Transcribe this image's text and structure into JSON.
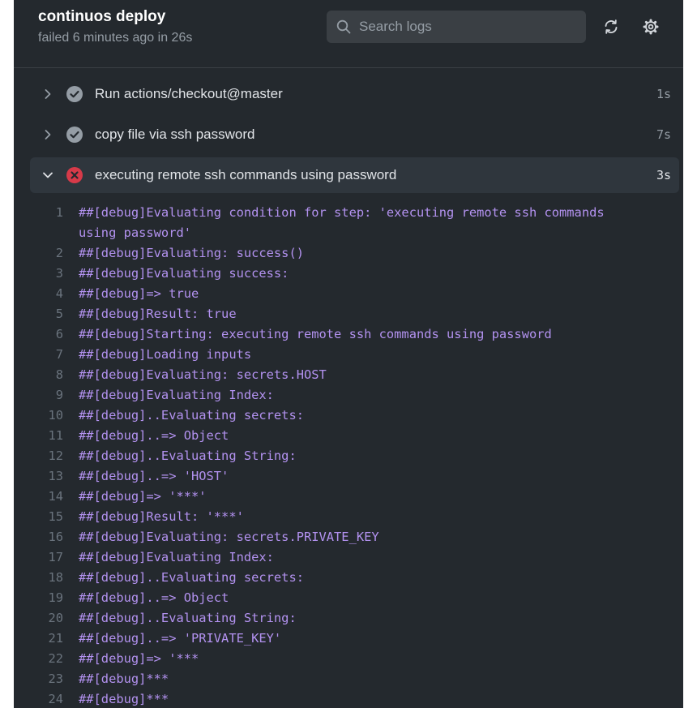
{
  "header": {
    "title": "continuos deploy",
    "subtitle": "failed 6 minutes ago in 26s",
    "search_placeholder": "Search logs"
  },
  "steps": [
    {
      "name": "Run actions/checkout@master",
      "time": "1s",
      "status": "success",
      "expanded": false
    },
    {
      "name": "copy file via ssh password",
      "time": "7s",
      "status": "success",
      "expanded": false
    },
    {
      "name": "executing remote ssh commands using password",
      "time": "3s",
      "status": "failure",
      "expanded": true
    }
  ],
  "colors": {
    "panel_bg": "#24292e",
    "log_text": "#b392f0",
    "failure": "#d73a49",
    "success": "#959da5"
  },
  "log_lines": [
    {
      "n": "1",
      "text": "##[debug]Evaluating condition for step: 'executing remote ssh commands using password'"
    },
    {
      "n": "2",
      "text": "##[debug]Evaluating: success()"
    },
    {
      "n": "3",
      "text": "##[debug]Evaluating success:"
    },
    {
      "n": "4",
      "text": "##[debug]=> true"
    },
    {
      "n": "5",
      "text": "##[debug]Result: true"
    },
    {
      "n": "6",
      "text": "##[debug]Starting: executing remote ssh commands using password"
    },
    {
      "n": "7",
      "text": "##[debug]Loading inputs"
    },
    {
      "n": "8",
      "text": "##[debug]Evaluating: secrets.HOST"
    },
    {
      "n": "9",
      "text": "##[debug]Evaluating Index:"
    },
    {
      "n": "10",
      "text": "##[debug]..Evaluating secrets:"
    },
    {
      "n": "11",
      "text": "##[debug]..=> Object"
    },
    {
      "n": "12",
      "text": "##[debug]..Evaluating String:"
    },
    {
      "n": "13",
      "text": "##[debug]..=> 'HOST'"
    },
    {
      "n": "14",
      "text": "##[debug]=> '***'"
    },
    {
      "n": "15",
      "text": "##[debug]Result: '***'"
    },
    {
      "n": "16",
      "text": "##[debug]Evaluating: secrets.PRIVATE_KEY"
    },
    {
      "n": "17",
      "text": "##[debug]Evaluating Index:"
    },
    {
      "n": "18",
      "text": "##[debug]..Evaluating secrets:"
    },
    {
      "n": "19",
      "text": "##[debug]..=> Object"
    },
    {
      "n": "20",
      "text": "##[debug]..Evaluating String:"
    },
    {
      "n": "21",
      "text": "##[debug]..=> 'PRIVATE_KEY'"
    },
    {
      "n": "22",
      "text": "##[debug]=> '***"
    },
    {
      "n": "23",
      "text": "##[debug]***"
    },
    {
      "n": "24",
      "text": "##[debug]***"
    }
  ]
}
